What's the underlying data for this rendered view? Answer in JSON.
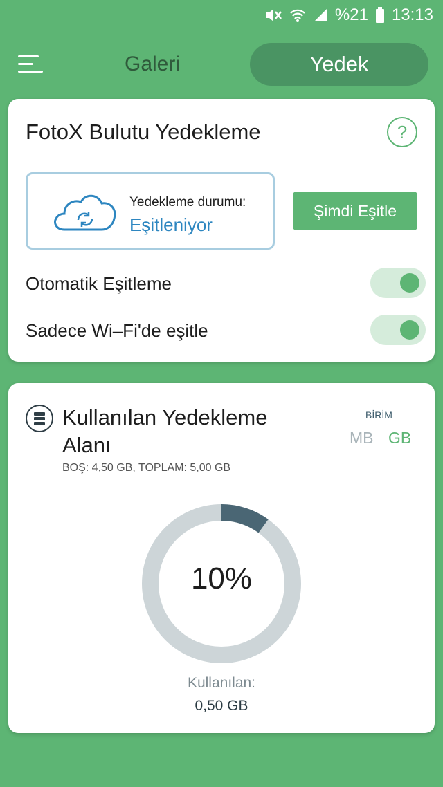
{
  "status_bar": {
    "battery_text": "%21",
    "time": "13:13",
    "icons": [
      "mute-icon",
      "wifi-icon",
      "signal-icon",
      "battery-icon"
    ]
  },
  "nav": {
    "menu_icon": "menu-icon",
    "tabs": [
      {
        "label": "Galeri",
        "active": false
      },
      {
        "label": "Yedek",
        "active": true
      }
    ]
  },
  "backup_card": {
    "title": "FotoX Bulutu Yedekleme",
    "help_label": "?",
    "status_label": "Yedekleme durumu:",
    "status_value": "Eşitleniyor",
    "sync_button": "Şimdi Eşitle",
    "toggles": [
      {
        "label": "Otomatik Eşitleme",
        "on": true
      },
      {
        "label": "Sadece Wi–Fi'de eşitle",
        "on": true
      }
    ]
  },
  "storage_card": {
    "title": "Kullanılan Yedekleme Alanı",
    "subtitle": "BOŞ: 4,50 GB, TOPLAM: 5,00 GB",
    "unit_label": "BİRİM",
    "units": [
      "MB",
      "GB"
    ],
    "selected_unit": "GB",
    "percent_text": "10%",
    "used_fraction": 0.1,
    "used_label": "Kullanılan:",
    "used_value": "0,50 GB"
  },
  "colors": {
    "accent": "#5db574",
    "active_tab": "#4a9463",
    "status_value": "#2d86c0",
    "donut_used": "#4a6674",
    "donut_track": "#cdd5d8"
  }
}
